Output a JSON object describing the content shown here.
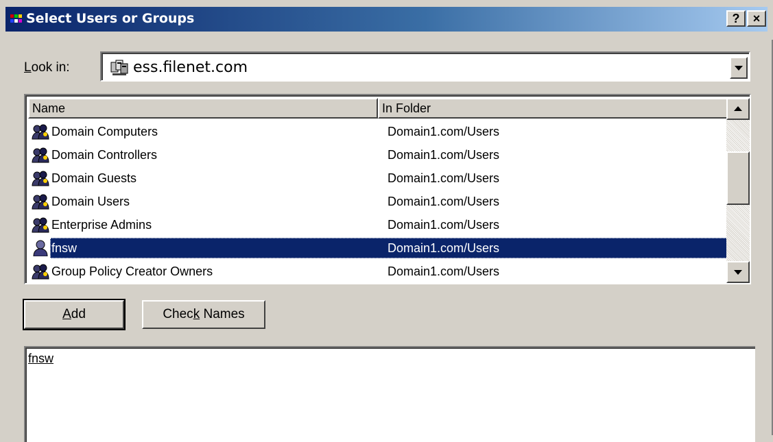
{
  "window": {
    "title": "Select Users or Groups",
    "help_button": "?",
    "close_button": "×"
  },
  "lookin": {
    "label_accel": "L",
    "label_rest": "ook in:",
    "value": "ess.filenet.com"
  },
  "list": {
    "columns": [
      "Name",
      "In Folder"
    ],
    "rows": [
      {
        "name": "Domain Computers",
        "folder": "Domain1.com/Users",
        "icon": "group-icon"
      },
      {
        "name": "Domain Controllers",
        "folder": "Domain1.com/Users",
        "icon": "group-icon"
      },
      {
        "name": "Domain Guests",
        "folder": "Domain1.com/Users",
        "icon": "group-icon"
      },
      {
        "name": "Domain Users",
        "folder": "Domain1.com/Users",
        "icon": "group-icon"
      },
      {
        "name": "Enterprise Admins",
        "folder": "Domain1.com/Users",
        "icon": "group-icon"
      },
      {
        "name": "fnsw",
        "folder": "Domain1.com/Users",
        "icon": "user-icon",
        "selected": true
      },
      {
        "name": "Group Policy Creator Owners",
        "folder": "Domain1.com/Users",
        "icon": "group-icon"
      }
    ]
  },
  "buttons": {
    "add_accel": "A",
    "add_rest": "dd",
    "check_pre": "Chec",
    "check_accel": "k",
    "check_post": " Names"
  },
  "selected_names": {
    "text": "fnsw"
  },
  "colors": {
    "title_gradient_start": "#0a246a",
    "title_gradient_end": "#a6caf0",
    "selection": "#0a246a",
    "face": "#d4d0c8"
  }
}
